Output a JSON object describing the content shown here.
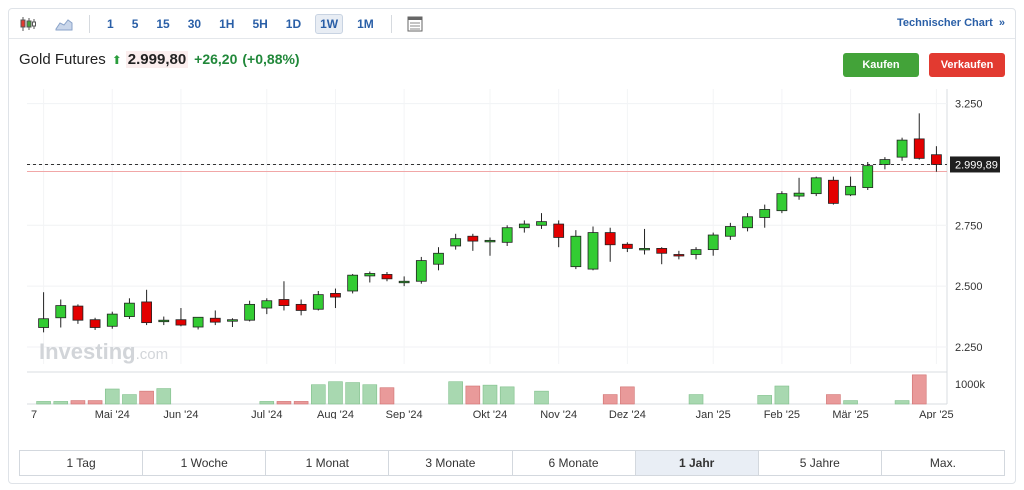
{
  "toolbar": {
    "timeframes": [
      "1",
      "5",
      "15",
      "30",
      "1H",
      "5H",
      "1D",
      "1W",
      "1M"
    ],
    "active_timeframe": "1W",
    "technical_link": "Technischer Chart"
  },
  "header": {
    "title": "Gold Futures",
    "price": "2.999,80",
    "change": "+26,20",
    "change_pct": "(+0,88%)"
  },
  "buttons": {
    "buy": "Kaufen",
    "sell": "Verkaufen"
  },
  "watermark": {
    "brand": "Investing",
    "suffix": ".com"
  },
  "chart_data": {
    "type": "candlestick",
    "y_ticks": [
      "3.250",
      "3.000",
      "2.750",
      "2.500",
      "2.250"
    ],
    "y_tick_values": [
      3250,
      3000,
      2750,
      2500,
      2250
    ],
    "ylim": [
      2180,
      3310
    ],
    "volume_label": "1000k",
    "current_price_label": "2.999,89",
    "current_price": 2999.89,
    "x_labels": [
      "7",
      "Mai '24",
      "Jun '24",
      "Jul '24",
      "Aug '24",
      "Sep '24",
      "Okt '24",
      "Nov '24",
      "Dez '24",
      "Jan '25",
      "Feb '25",
      "Mär '25",
      "Apr '25"
    ],
    "x_label_index": [
      0,
      4,
      8,
      13,
      17,
      21,
      26,
      30,
      34,
      39,
      43,
      47,
      52
    ],
    "ohlc": [
      [
        2330,
        2475,
        2310,
        2366
      ],
      [
        2370,
        2445,
        2330,
        2420
      ],
      [
        2418,
        2425,
        2345,
        2360
      ],
      [
        2362,
        2370,
        2320,
        2330
      ],
      [
        2335,
        2395,
        2325,
        2385
      ],
      [
        2375,
        2450,
        2365,
        2430
      ],
      [
        2435,
        2485,
        2340,
        2350
      ],
      [
        2355,
        2375,
        2340,
        2360
      ],
      [
        2362,
        2410,
        2335,
        2340
      ],
      [
        2332,
        2372,
        2322,
        2372
      ],
      [
        2368,
        2400,
        2340,
        2352
      ],
      [
        2356,
        2368,
        2332,
        2362
      ],
      [
        2360,
        2440,
        2355,
        2425
      ],
      [
        2410,
        2450,
        2385,
        2440
      ],
      [
        2445,
        2520,
        2400,
        2420
      ],
      [
        2425,
        2445,
        2380,
        2400
      ],
      [
        2405,
        2480,
        2400,
        2465
      ],
      [
        2470,
        2490,
        2410,
        2455
      ],
      [
        2480,
        2550,
        2470,
        2545
      ],
      [
        2542,
        2560,
        2515,
        2552
      ],
      [
        2548,
        2558,
        2520,
        2530
      ],
      [
        2515,
        2540,
        2500,
        2520
      ],
      [
        2520,
        2620,
        2510,
        2605
      ],
      [
        2590,
        2660,
        2565,
        2635
      ],
      [
        2665,
        2715,
        2650,
        2695
      ],
      [
        2705,
        2715,
        2645,
        2685
      ],
      [
        2686,
        2700,
        2625,
        2688
      ],
      [
        2680,
        2750,
        2665,
        2740
      ],
      [
        2740,
        2770,
        2720,
        2755
      ],
      [
        2750,
        2800,
        2735,
        2765
      ],
      [
        2755,
        2770,
        2660,
        2700
      ],
      [
        2580,
        2730,
        2570,
        2705
      ],
      [
        2570,
        2745,
        2565,
        2720
      ],
      [
        2720,
        2740,
        2600,
        2670
      ],
      [
        2672,
        2680,
        2640,
        2655
      ],
      [
        2650,
        2735,
        2630,
        2655
      ],
      [
        2655,
        2660,
        2590,
        2635
      ],
      [
        2630,
        2645,
        2610,
        2625
      ],
      [
        2630,
        2660,
        2610,
        2650
      ],
      [
        2650,
        2720,
        2625,
        2710
      ],
      [
        2705,
        2760,
        2690,
        2745
      ],
      [
        2740,
        2800,
        2725,
        2785
      ],
      [
        2782,
        2835,
        2740,
        2815
      ],
      [
        2810,
        2890,
        2800,
        2880
      ],
      [
        2870,
        2945,
        2855,
        2882
      ],
      [
        2880,
        2950,
        2870,
        2945
      ],
      [
        2935,
        2950,
        2835,
        2840
      ],
      [
        2875,
        2950,
        2870,
        2910
      ],
      [
        2905,
        3010,
        2895,
        2995
      ],
      [
        3000,
        3030,
        2980,
        3020
      ],
      [
        3030,
        3110,
        3015,
        3100
      ],
      [
        3105,
        3210,
        3020,
        3025
      ],
      [
        3040,
        3075,
        2970,
        2999.89
      ]
    ],
    "volume": [
      [
        0,
        6,
        "up"
      ],
      [
        1,
        6,
        "up"
      ],
      [
        2,
        8,
        "dn"
      ],
      [
        3,
        8,
        "dn"
      ],
      [
        4,
        35,
        "up"
      ],
      [
        5,
        22,
        "up"
      ],
      [
        6,
        30,
        "dn"
      ],
      [
        7,
        36,
        "up"
      ],
      [
        13,
        6,
        "up"
      ],
      [
        14,
        6,
        "dn"
      ],
      [
        15,
        6,
        "dn"
      ],
      [
        16,
        45,
        "up"
      ],
      [
        17,
        52,
        "up"
      ],
      [
        18,
        50,
        "up"
      ],
      [
        19,
        45,
        "up"
      ],
      [
        20,
        38,
        "dn"
      ],
      [
        24,
        52,
        "up"
      ],
      [
        25,
        42,
        "dn"
      ],
      [
        26,
        44,
        "up"
      ],
      [
        27,
        40,
        "up"
      ],
      [
        29,
        30,
        "up"
      ],
      [
        33,
        22,
        "dn"
      ],
      [
        34,
        40,
        "dn"
      ],
      [
        38,
        22,
        "up"
      ],
      [
        42,
        20,
        "up"
      ],
      [
        43,
        42,
        "up"
      ],
      [
        46,
        22,
        "dn"
      ],
      [
        47,
        8,
        "up"
      ],
      [
        50,
        8,
        "up"
      ],
      [
        51,
        68,
        "dn"
      ]
    ]
  },
  "ranges": [
    "1 Tag",
    "1 Woche",
    "1 Monat",
    "3 Monate",
    "6 Monate",
    "1 Jahr",
    "5 Jahre",
    "Max."
  ],
  "active_range": "1 Jahr",
  "colors": {
    "up": "#33cc33",
    "down": "#e30000",
    "accent": "#2a5fa7",
    "buy": "#43a339",
    "sell": "#e23a30"
  }
}
